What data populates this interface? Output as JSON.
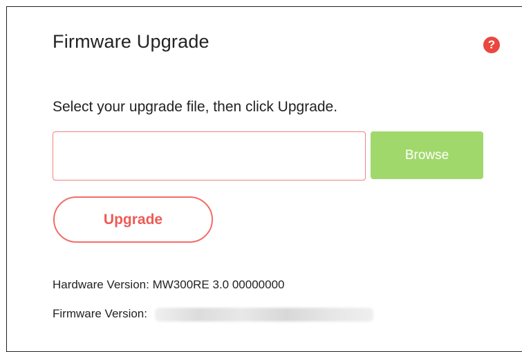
{
  "page": {
    "title": "Firmware Upgrade",
    "help_icon": "question-icon",
    "help_label": "?"
  },
  "upgrade_form": {
    "instruction": "Select your upgrade file, then click Upgrade.",
    "file_value": "",
    "browse_label": "Browse",
    "upgrade_label": "Upgrade"
  },
  "info": {
    "hardware_label": "Hardware Version:",
    "hardware_value": "MW300RE 3.0 00000000",
    "firmware_label": "Firmware Version:"
  },
  "colors": {
    "accent_red": "#f26c68",
    "help_red": "#e9473f",
    "browse_green": "#a1d86b"
  }
}
